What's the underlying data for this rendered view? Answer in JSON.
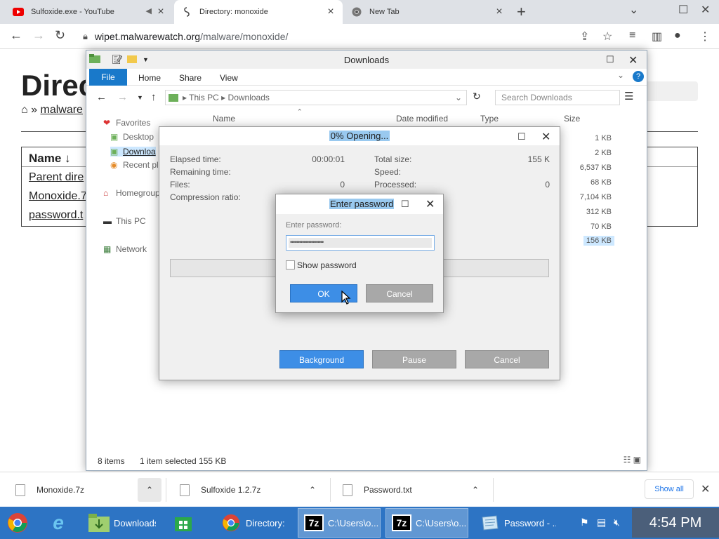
{
  "browser": {
    "tabs": [
      {
        "title": "Sulfoxide.exe - YouTube",
        "icon": "youtube-icon"
      },
      {
        "title": "Directory: monoxide",
        "icon": "directory-icon",
        "active": true
      },
      {
        "title": "New Tab",
        "icon": "chrome-icon"
      }
    ],
    "url_host": "wipet.malwarewatch.org",
    "url_path": "/malware/monoxide/"
  },
  "webpage": {
    "heading": "Direc",
    "breadcrumb_home": "⌂",
    "breadcrumb_sep": "»",
    "breadcrumb_link": "malware",
    "table_header": "Name ↓",
    "rows": [
      "Parent dire",
      "Monoxide.7",
      "password.t"
    ]
  },
  "explorer": {
    "title": "Downloads",
    "ribbon": {
      "file": "File",
      "home": "Home",
      "share": "Share",
      "view": "View"
    },
    "path": [
      "This PC",
      "Downloads"
    ],
    "search_placeholder": "Search Downloads",
    "columns": {
      "name": "Name",
      "date": "Date modified",
      "type": "Type",
      "size": "Size"
    },
    "nav": {
      "favorites": "Favorites",
      "desktop": "Desktop",
      "downloads": "Downloa",
      "recent": "Recent pl",
      "homegroup": "Homegroup",
      "thispc": "This PC",
      "network": "Network"
    },
    "sizes": [
      "1 KB",
      "2 KB",
      "6,537 KB",
      "68 KB",
      "7,104 KB",
      "312 KB",
      "70 KB",
      "156 KB"
    ],
    "status_items": "8 items",
    "status_selected": "1 item selected  155 KB"
  },
  "progress_dialog": {
    "title": "0% Opening...",
    "elapsed_label": "Elapsed time:",
    "elapsed_value": "00:00:01",
    "remaining_label": "Remaining time:",
    "files_label": "Files:",
    "files_value": "0",
    "ratio_label": "Compression ratio:",
    "total_label": "Total size:",
    "total_value": "155 K",
    "speed_label": "Speed:",
    "processed_label": "Processed:",
    "processed_value": "0",
    "buttons": {
      "background": "Background",
      "pause": "Pause",
      "cancel": "Cancel"
    }
  },
  "password_dialog": {
    "title": "Enter password",
    "label": "Enter password:",
    "masked_value": "••••••••••••••••••••••",
    "show_password": "Show password",
    "ok": "OK",
    "cancel": "Cancel"
  },
  "downloads_shelf": {
    "items": [
      "Monoxide.7z",
      "Sulfoxide 1.2.7z",
      "Password.txt"
    ],
    "show_all": "Show all"
  },
  "taskbar": {
    "items": [
      {
        "label": "",
        "icon": "chrome-logo-icon"
      },
      {
        "label": "",
        "icon": "internet-explorer-icon"
      },
      {
        "label": "Downloads",
        "icon": "folder-icon"
      },
      {
        "label": "",
        "icon": "store-icon"
      },
      {
        "label": "Directory: ...",
        "icon": "chrome-icon"
      },
      {
        "label": "C:\\Users\\o...",
        "icon": "7zip-icon"
      },
      {
        "label": "C:\\Users\\o...",
        "icon": "7zip-icon"
      },
      {
        "label": "Password - ...",
        "icon": "notepad-icon"
      }
    ],
    "clock": "4:54 PM"
  }
}
